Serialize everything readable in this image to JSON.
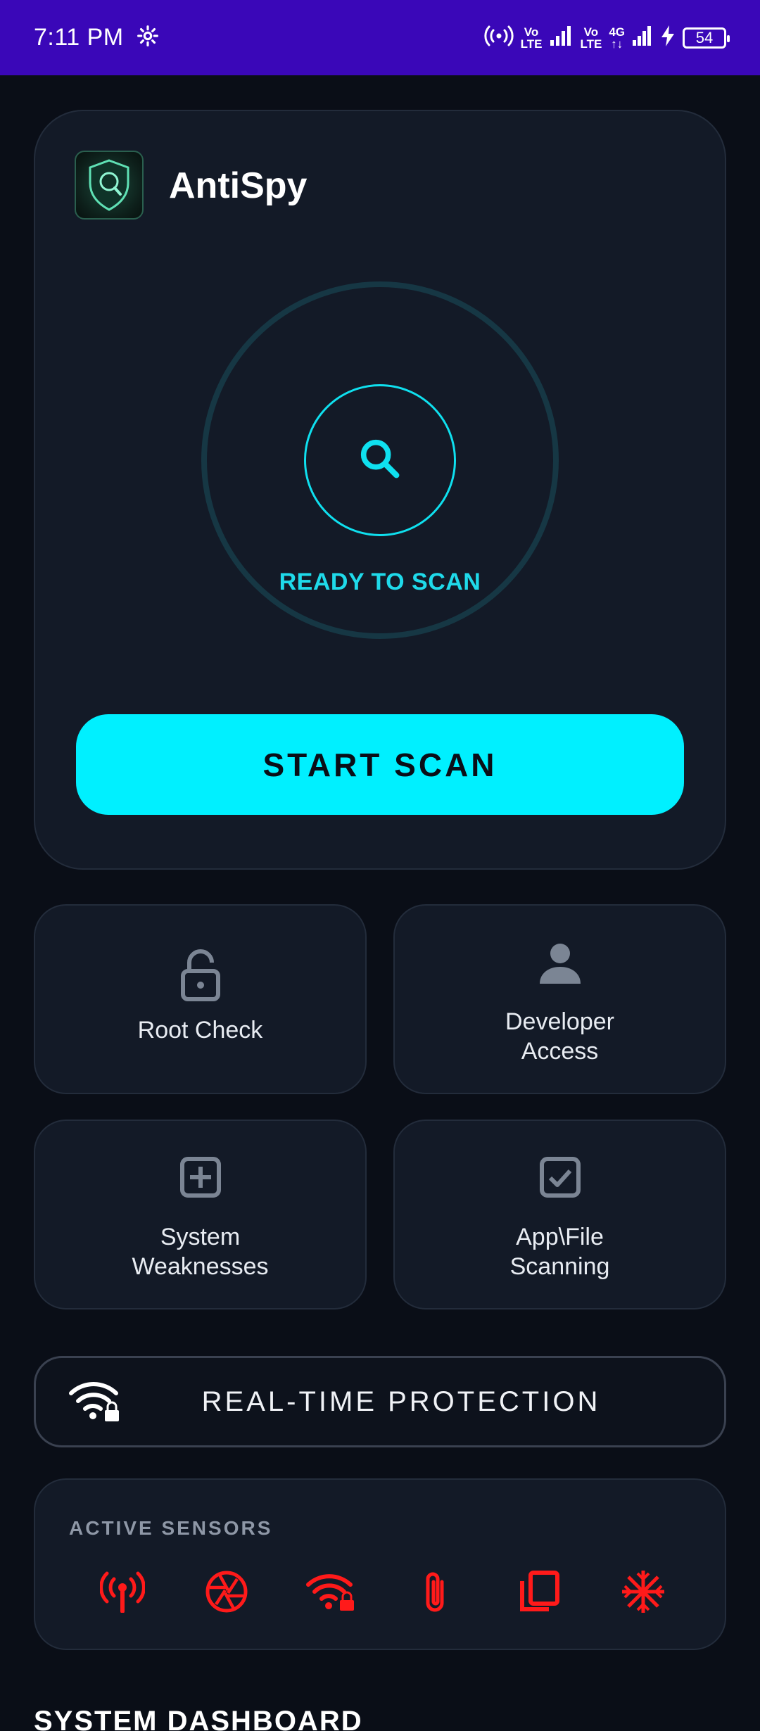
{
  "status_bar": {
    "time": "7:11 PM",
    "network_1": [
      "Vo",
      "LTE"
    ],
    "network_2": [
      "Vo",
      "LTE"
    ],
    "network_type": [
      "4G",
      "↑↓"
    ],
    "battery": "54",
    "icons": [
      "gear-icon",
      "hotspot-icon",
      "signal-icon",
      "signal-icon",
      "charging-icon",
      "battery-icon"
    ]
  },
  "app": {
    "title": "AntiSpy",
    "logo_icon": "antispy-shield-logo"
  },
  "scanner": {
    "status": "READY TO SCAN",
    "icon": "search-icon",
    "accent_color": "#00f0ff",
    "start_label": "START SCAN"
  },
  "tiles": [
    {
      "label": "Root Check",
      "icon": "padlock-icon"
    },
    {
      "label": "Developer\nAccess",
      "icon": "person-icon"
    },
    {
      "label": "System\nWeaknesses",
      "icon": "plus-box-icon"
    },
    {
      "label": "App\\File\nScanning",
      "icon": "checkbox-icon"
    }
  ],
  "protection": {
    "label": "REAL-TIME PROTECTION",
    "icon": "wifi-lock-icon"
  },
  "sensors": {
    "title": "ACTIVE SENSORS",
    "alert_color": "#ff1a1a",
    "items": [
      "antenna-icon",
      "camera-shutter-icon",
      "wifi-lock-icon",
      "paperclip-icon",
      "copy-icon",
      "snowflake-icon"
    ]
  },
  "dashboard": {
    "title": "SYSTEM DASHBOARD"
  }
}
